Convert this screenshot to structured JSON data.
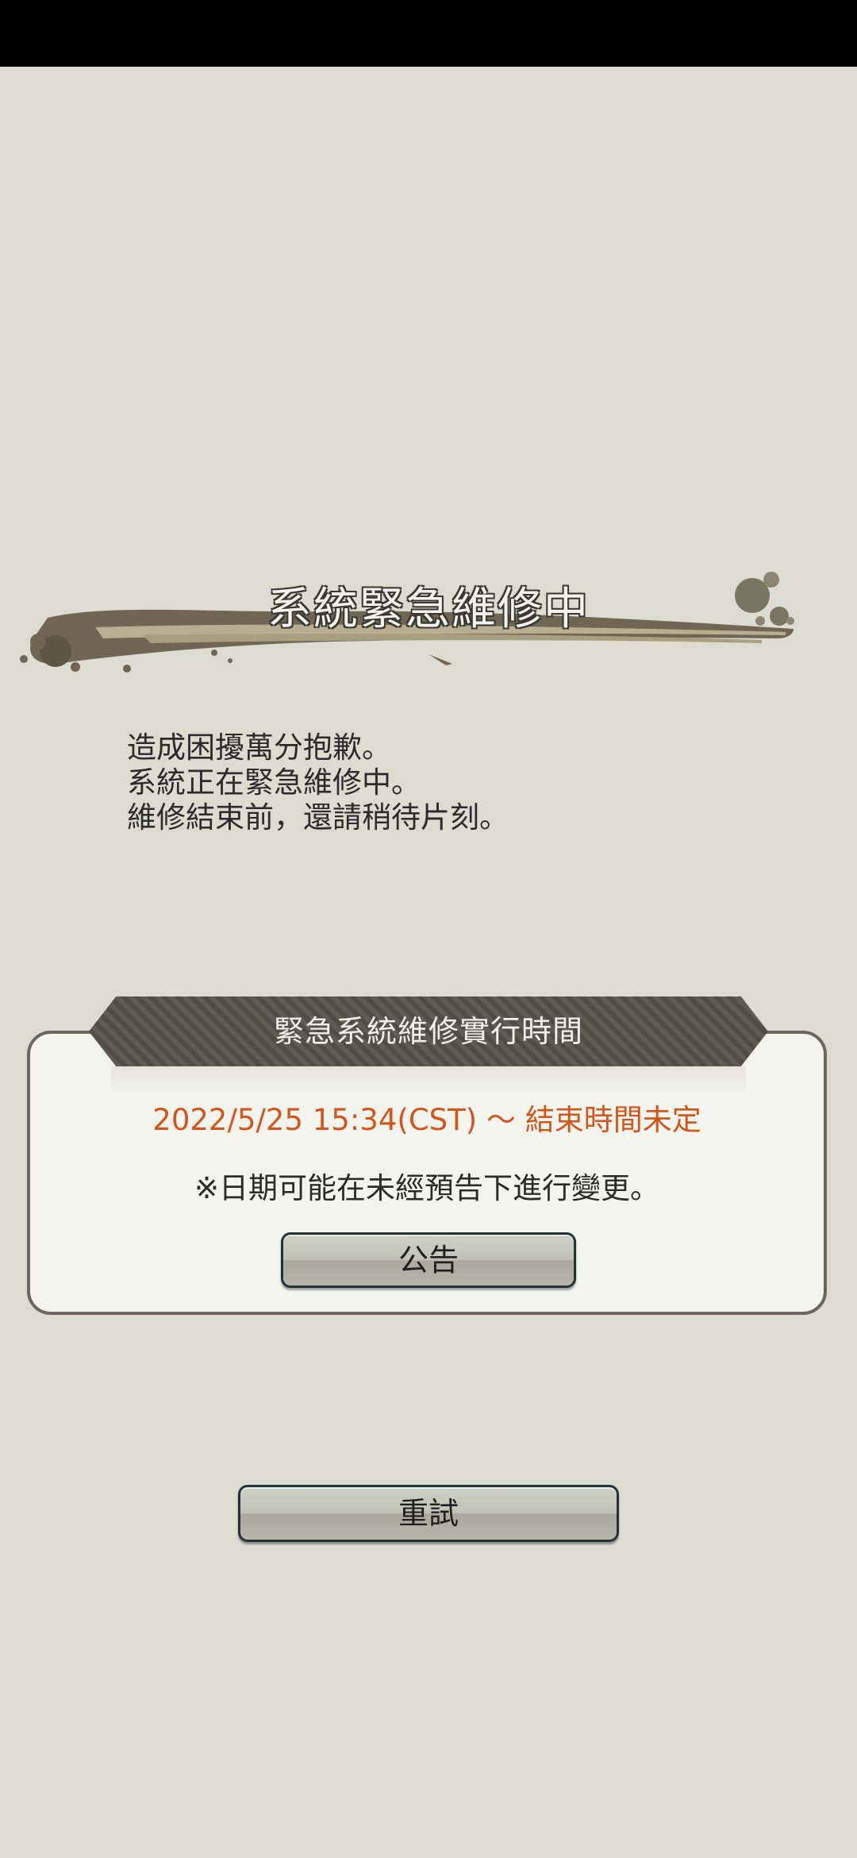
{
  "maintenance": {
    "title": "系統緊急維修中",
    "message_lines": [
      "造成困擾萬分抱歉。",
      "系統正在緊急維修中。",
      "維修結束前，還請稍待片刻。"
    ]
  },
  "schedule_panel": {
    "header": "緊急系統維修實行時間",
    "schedule_text": "2022/5/25 15:34(CST) ～ 結束時間未定",
    "note": "※日期可能在未經預告下進行變更。",
    "notice_button_label": "公告"
  },
  "retry_button_label": "重試",
  "colors": {
    "background": "#dcdcd1",
    "header_band": "#565148",
    "schedule_text": "#d2561c",
    "button_border": "#24313a"
  }
}
